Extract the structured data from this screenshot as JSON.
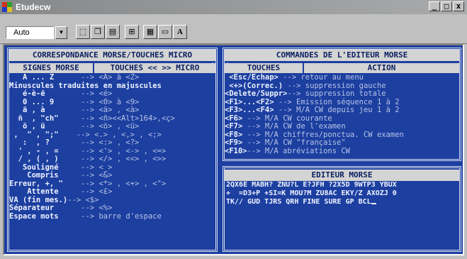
{
  "window": {
    "title": "Etudecw",
    "controls": [
      "_",
      "□",
      "x"
    ]
  },
  "toolbar": {
    "font_value": "Auto",
    "bold_label": "A"
  },
  "left_panel": {
    "title": "CORRESPONDANCE MORSE/TOUCHES MICRO",
    "col_signs": "SIGNES MORSE",
    "col_keys": "TOUCHES << >> MICRO",
    "rows": [
      {
        "sign": "   A ... Z      ",
        "key": "--> <A> à <Z>"
      },
      {
        "sign": "Minuscules traduites en majuscules",
        "key": ""
      },
      {
        "sign": "   é-è-ë        ",
        "key": "--> <é>"
      },
      {
        "sign": "   0 ... 9      ",
        "key": "--> <0> à <9>"
      },
      {
        "sign": "   ä , à        ",
        "key": "--> <ä> , <à>"
      },
      {
        "sign": "  ñ  , \"ch\"     ",
        "key": "--> <ñ><<Alt>164>,<ç>"
      },
      {
        "sign": "   ö , ü        ",
        "key": "--> <ö> , <ü>"
      },
      {
        "sign": " ,  \" , \";\"    ",
        "key": "--> <.> , <,> , <;>"
      },
      {
        "sign": "   :  , ?       ",
        "key": "--> <:> , <?>"
      },
      {
        "sign": "  ' , - , =     ",
        "key": "--> <'> , <-> , <=>"
      },
      {
        "sign": "  / , ( , )     ",
        "key": "--> </> , <<> , <>>"
      },
      {
        "sign": "   Souligné     ",
        "key": "--> <_>"
      },
      {
        "sign": "    Compris     ",
        "key": "--> <&>"
      },
      {
        "sign": "Erreur, +, \"    ",
        "key": "--> <*> , <+> , <\">"
      },
      {
        "sign": "    Attente     ",
        "key": "--> <£>"
      },
      {
        "sign": "VA (fin mes.)",
        "key": "--> <$>"
      },
      {
        "sign": "Séparateur      ",
        "key": "--> <%>"
      },
      {
        "sign": "Espace mots     ",
        "key": "--> barre d'espace"
      }
    ]
  },
  "right_top_panel": {
    "title": "COMMANDES DE L'EDITEUR MORSE",
    "col_keys": "TOUCHES",
    "col_action": "ACTION",
    "rows": [
      {
        "key": " <Esc/Echap>",
        "action": " --> retour au menu"
      },
      {
        "key": " <+>(Correc.)",
        "action": " --> suppression gauche"
      },
      {
        "key": "<Delete/Suppr>",
        "action": "--> suppression totale"
      },
      {
        "key": "<F1>...<F2>",
        "action": " --> Emission séquence 1 à 2"
      },
      {
        "key": "<F3>...<F4>",
        "action": " --> M/A CW depuis jeu 1 à 2"
      },
      {
        "key": "<F6>",
        "action": " --> M/A CW courante"
      },
      {
        "key": "<F7>",
        "action": " --> M/A CW de l'examen"
      },
      {
        "key": "<F8>",
        "action": " --> M/A chiffres/ponctua. CW examen"
      },
      {
        "key": "<F9>",
        "action": " --> M/A CW \"française\""
      },
      {
        "key": "<F10>",
        "action": "--> M/A abréviations CW"
      }
    ]
  },
  "right_bottom_panel": {
    "title": "EDITEUR MORSE",
    "lines": [
      "2QX6E MABH? ZNU?L E?JFH ?2X5D 9WTP3 YBUX",
      "+  =D3+P +SI=K MOU?M ZU8AC EKY/Z AXOZJ 0",
      "TK// GUD TJRS QRH FINE SURE GP BCL"
    ]
  },
  "colors": {
    "console_bg": "#1c3fa0",
    "text": "#eef2ff",
    "header_bg": "#d4d4d4"
  }
}
